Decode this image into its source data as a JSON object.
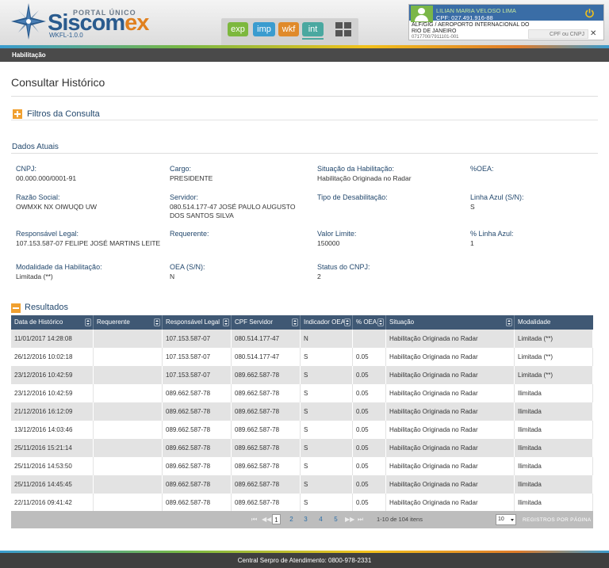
{
  "header": {
    "portal": "PORTAL ÚNICO",
    "logo_main": "Siscom",
    "logo_accent": "ex",
    "version": "WKFL-1.0.0",
    "app_tabs": [
      "exp",
      "imp",
      "wkf",
      "int"
    ],
    "user": {
      "name": "LILIAN MARIA VELOSO LIMA",
      "cpf": "CPF: 027.491.916-88",
      "org": "ALF/GIG / AEROPORTO INTERNACIONAL DO RIO DE JANEIRO",
      "code": "0717700/7911101-001",
      "cpf_search_placeholder": "CPF ou CNPJ",
      "clear": "✕"
    },
    "colors": {
      "exp": "#7db83e",
      "imp": "#3a9ccf",
      "wkf": "#e08a2a",
      "int": "#4aa8a0",
      "user_bar": "#3a6da6"
    }
  },
  "menubar": {
    "current": "Habilitação"
  },
  "page": {
    "title": "Consultar Histórico",
    "filters_label": "Filtros da Consulta",
    "current_data_title": "Dados Atuais",
    "results_label": "Resultados"
  },
  "fields": {
    "cnpj_label": "CNPJ:",
    "cnpj_value": "00.000.000/0001-91",
    "cargo_label": "Cargo:",
    "cargo_value": "PRESIDENTE",
    "situacao_label": "Situação da Habilitação:",
    "situacao_value": "Habilitação Originada no Radar",
    "oea_pct_label": "%OEA:",
    "razao_label": "Razão Social:",
    "razao_value": "OWMXK NX OIWUQD UW",
    "servidor_label": "Servidor:",
    "servidor_value": "080.514.177-47 JOSÉ PAULO AUGUSTO DOS SANTOS SILVA",
    "tipo_desab_label": "Tipo de Desabilitação:",
    "linha_azul_label": "Linha Azul (S/N):",
    "linha_azul_value": "S",
    "resp_legal_label": "Responsável Legal:",
    "resp_legal_value": "107.153.587-07 FELIPE JOSÉ MARTINS LEITE",
    "requerente_label": "Requerente:",
    "valor_limite_label": "Valor Limite:",
    "valor_limite_value": "150000",
    "pct_linha_azul_label": "% Linha Azul:",
    "pct_linha_azul_value": "1",
    "modalidade_label": "Modalidade da Habilitação:",
    "modalidade_value": "Limitada (**)",
    "oea_sn_label": "OEA (S/N):",
    "oea_sn_value": "N",
    "status_cnpj_label": "Status do CNPJ:",
    "status_cnpj_value": "2"
  },
  "table": {
    "columns": [
      "Data de Histórico",
      "Requerente",
      "Responsável Legal",
      "CPF Servidor",
      "Indicador OEA",
      "% OEA",
      "Situação",
      "Modalidade"
    ],
    "rows": [
      [
        "11/01/2017 14:28:08",
        "",
        "107.153.587-07",
        "080.514.177-47",
        "N",
        "",
        "Habilitação Originada no Radar",
        "Limitada (**)"
      ],
      [
        "26/12/2016 10:02:18",
        "",
        "107.153.587-07",
        "080.514.177-47",
        "S",
        "0.05",
        "Habilitação Originada no Radar",
        "Limitada (**)"
      ],
      [
        "23/12/2016 10:42:59",
        "",
        "107.153.587-07",
        "089.662.587-78",
        "S",
        "0.05",
        "Habilitação Originada no Radar",
        "Limitada (**)"
      ],
      [
        "23/12/2016 10:42:59",
        "",
        "089.662.587-78",
        "089.662.587-78",
        "S",
        "0.05",
        "Habilitação Originada no Radar",
        "Ilimitada"
      ],
      [
        "21/12/2016 16:12:09",
        "",
        "089.662.587-78",
        "089.662.587-78",
        "S",
        "0.05",
        "Habilitação Originada no Radar",
        "Ilimitada"
      ],
      [
        "13/12/2016 14:03:46",
        "",
        "089.662.587-78",
        "089.662.587-78",
        "S",
        "0.05",
        "Habilitação Originada no Radar",
        "Ilimitada"
      ],
      [
        "25/11/2016 15:21:14",
        "",
        "089.662.587-78",
        "089.662.587-78",
        "S",
        "0.05",
        "Habilitação Originada no Radar",
        "Ilimitada"
      ],
      [
        "25/11/2016 14:53:50",
        "",
        "089.662.587-78",
        "089.662.587-78",
        "S",
        "0.05",
        "Habilitação Originada no Radar",
        "Ilimitada"
      ],
      [
        "25/11/2016 14:45:45",
        "",
        "089.662.587-78",
        "089.662.587-78",
        "S",
        "0.05",
        "Habilitação Originada no Radar",
        "Ilimitada"
      ],
      [
        "22/11/2016 09:41:42",
        "",
        "089.662.587-78",
        "089.662.587-78",
        "S",
        "0.05",
        "Habilitação Originada no Radar",
        "Ilimitada"
      ]
    ]
  },
  "pager": {
    "first": "⏮",
    "prev": "◀◀",
    "pages": [
      "1",
      "2",
      "3",
      "4",
      "5"
    ],
    "current_page": "1",
    "next": "▶▶",
    "last": "⏭",
    "info": "1-10 de 104 itens",
    "page_size": "10",
    "page_size_label": "REGISTROS POR PÁGINA"
  },
  "footer": {
    "text": "Central Serpro de Atendimento: 0800-978-2331"
  }
}
